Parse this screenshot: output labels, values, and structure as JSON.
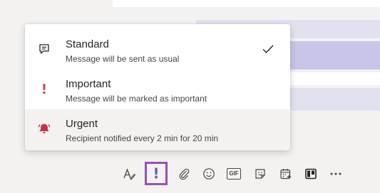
{
  "menu": {
    "items": [
      {
        "id": "standard",
        "title": "Standard",
        "description": "Message will be sent as usual",
        "icon": "message-icon",
        "selected": true
      },
      {
        "id": "important",
        "title": "Important",
        "description": "Message will be marked as important",
        "icon": "exclamation-icon",
        "selected": false
      },
      {
        "id": "urgent",
        "title": "Urgent",
        "description": "Recipient notified every 2 min for 20 min",
        "icon": "bell-ringing-icon",
        "selected": false
      }
    ]
  },
  "toolbar": {
    "icons": [
      "format-icon",
      "priority-icon",
      "attach-icon",
      "emoji-icon",
      "gif-icon",
      "sticker-icon",
      "schedule-meeting-icon",
      "apps-icon",
      "more-options-icon"
    ],
    "gif_label": "GIF",
    "priority_mark": "!"
  },
  "colors": {
    "accent": "#6264a7",
    "urgent": "#c4314b",
    "important": "#c4314b",
    "highlight_box": "#9a4fb5",
    "selected_row_bg": "#f3f2f1"
  }
}
